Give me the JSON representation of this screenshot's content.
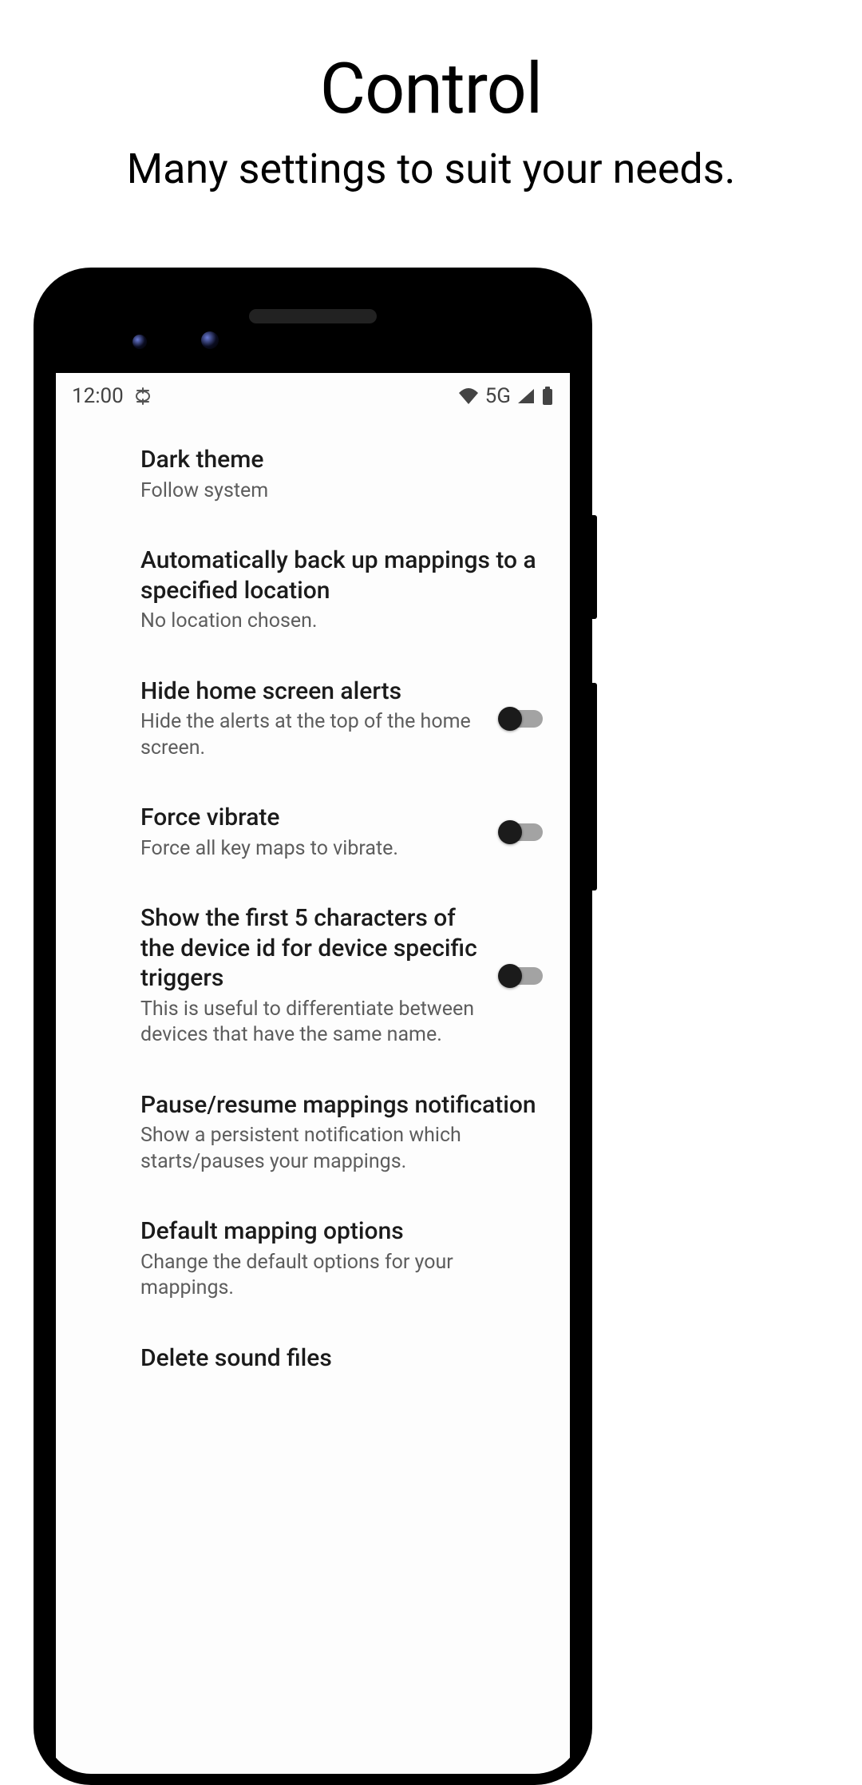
{
  "promo": {
    "title": "Control",
    "subtitle": "Many settings to suit your needs."
  },
  "status": {
    "time": "12:00",
    "network": "5G"
  },
  "settings": [
    {
      "title": "Dark theme",
      "desc": "Follow system",
      "toggle": null
    },
    {
      "title": "Automatically back up mappings to a specified location",
      "desc": "No location chosen.",
      "toggle": null
    },
    {
      "title": "Hide home screen alerts",
      "desc": "Hide the alerts at the top of the home screen.",
      "toggle": false
    },
    {
      "title": "Force vibrate",
      "desc": "Force all key maps to vibrate.",
      "toggle": false
    },
    {
      "title": "Show the first 5 characters of the device id for device specific triggers",
      "desc": "This is useful to differentiate between devices that have the same name.",
      "toggle": false
    },
    {
      "title": "Pause/resume mappings notification",
      "desc": "Show a persistent notification which starts/pauses your mappings.",
      "toggle": null
    },
    {
      "title": "Default mapping options",
      "desc": "Change the default options for your mappings.",
      "toggle": null
    },
    {
      "title": "Delete sound files",
      "desc": "",
      "toggle": null
    }
  ]
}
